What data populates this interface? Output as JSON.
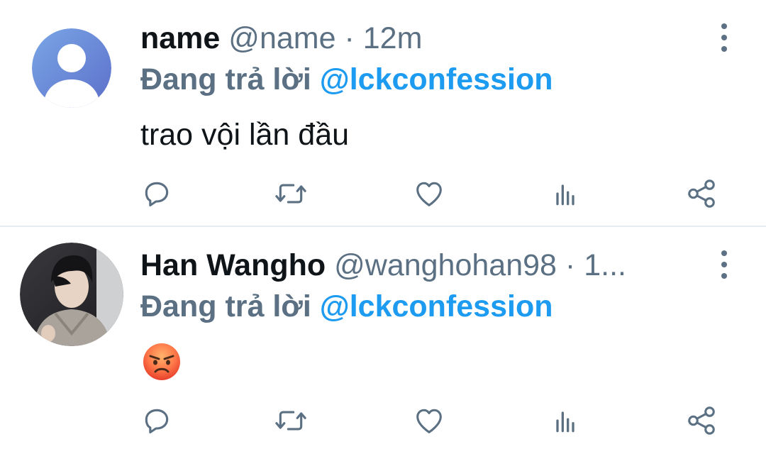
{
  "tweets": [
    {
      "display_name": "name",
      "handle": "@name",
      "separator": "·",
      "time": "12m",
      "reply_prefix": "Đang trả lời",
      "reply_to": "@lckconfession",
      "text": "trao vội lần đầu",
      "avatar": "default-profile-avatar",
      "avatar_colors": [
        "#7aa6e6",
        "#5c6fc9"
      ]
    },
    {
      "display_name": "Han Wangho",
      "handle": "@wanghohan98",
      "separator": "·",
      "time": "1...",
      "reply_prefix": "Đang trả lời",
      "reply_to": "@lckconfession",
      "text": "😡",
      "avatar": "profile-photo-avatar"
    }
  ],
  "actions": [
    "reply-icon",
    "retweet-icon",
    "like-icon",
    "views-icon",
    "share-icon"
  ],
  "colors": {
    "secondary_text": "#5b7083",
    "mention": "#1d9bf0",
    "divider": "#e6ecf0"
  }
}
